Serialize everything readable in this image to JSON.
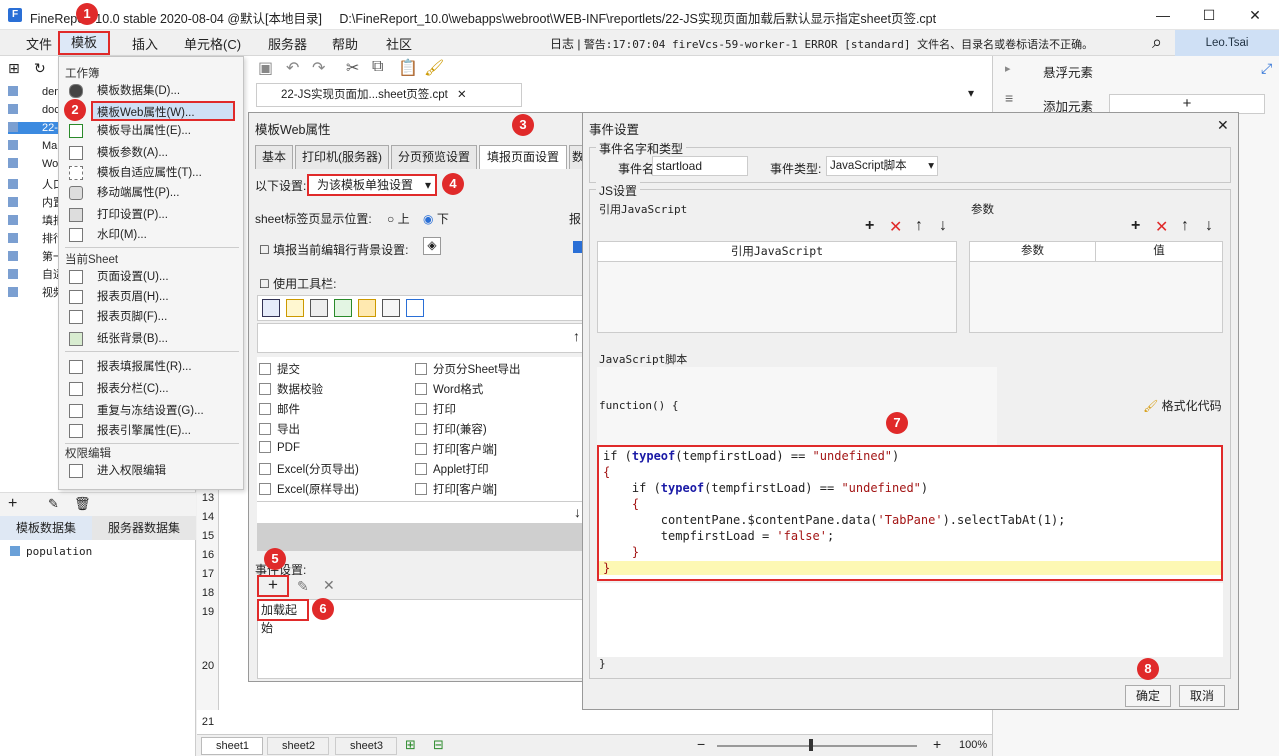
{
  "titlebar": {
    "app_title": "FineReport 10.0 stable 2020-08-04 @默认[本地目录]",
    "file_path": "D:\\FineReport_10.0\\webapps\\webroot\\WEB-INF\\reportlets/22-JS实现页面加载后默认显示指定sheet页签.cpt",
    "minimize": "—",
    "maximize": "☐",
    "close": "✕"
  },
  "menubar": {
    "items": [
      "文件",
      "模板",
      "插入",
      "单元格(C)",
      "服务器",
      "帮助",
      "社区"
    ],
    "log_label": "日志",
    "alert_text": "警告:17:07:04 fireVcs-59-worker-1 ERROR [standard] 文件名、目录名或卷标语法不正确。",
    "user": "Leo.Tsai"
  },
  "dropdown": {
    "section_workbook": "工作簿",
    "items_workbook": [
      "模板数据集(D)...",
      "模板Web属性(W)...",
      "模板导出属性(E)...",
      "模板参数(A)...",
      "模板自适应属性(T)...",
      "移动端属性(P)...",
      "打印设置(P)...",
      "水印(M)..."
    ],
    "section_sheet": "当前Sheet",
    "items_sheet1": [
      "页面设置(U)...",
      "报表页眉(H)...",
      "报表页脚(F)...",
      "纸张背景(B)..."
    ],
    "items_sheet2": [
      "报表填报属性(R)...",
      "报表分栏(C)...",
      "重复与冻结设置(G)...",
      "报表引擎属性(E)..."
    ],
    "section_perm": "权限编辑",
    "items_perm": [
      "进入权限编辑"
    ]
  },
  "left_panel": {
    "tree": [
      "dem",
      "doc",
      "22-",
      "Map",
      "Wor",
      "人口",
      "内置",
      "填报",
      "排行",
      "第一",
      "自适",
      "视频"
    ],
    "tab_template_ds": "模板数据集",
    "tab_server_ds": "服务器数据集",
    "dataset": "population"
  },
  "editor": {
    "tab_label": "22-JS实现页面加...sheet页签.cpt",
    "row_numbers": [
      "13",
      "14",
      "15",
      "16",
      "17",
      "18",
      "19",
      "20",
      "21"
    ],
    "sheets": [
      "sheet1",
      "sheet2",
      "sheet3"
    ],
    "zoom": "100%",
    "zoom_minus": "−",
    "zoom_plus": "+"
  },
  "right_panel": {
    "title": "悬浮元素",
    "add_label": "添加元素",
    "add_symbol": "+"
  },
  "dlg1": {
    "title": "模板Web属性",
    "tabs": [
      "基本",
      "打印机(服务器)",
      "分页预览设置",
      "填报页面设置",
      "数"
    ],
    "setting_label": "以下设置:",
    "setting_value": "为该模板单独设置",
    "sheet_pos_label": "sheet标签页显示位置:",
    "pos_top": "上",
    "pos_bottom": "下",
    "cut_label": "报",
    "bg_label": "填报当前编辑行背景设置:",
    "toolbar_label": "使用工具栏:",
    "list_col1": [
      "提交",
      "数据校验",
      "邮件",
      "导出",
      "PDF",
      "Excel(分页导出)",
      "Excel(原样导出)"
    ],
    "list_col2": [
      "分页分Sheet导出",
      "Word格式",
      "打印",
      "打印(兼容)",
      "打印[客户端]",
      "Applet打印",
      "打印[客户端]"
    ],
    "event_label": "事件设置:",
    "event_add": "+",
    "event_item": "加载起始"
  },
  "dlg2": {
    "title": "事件设置",
    "group_name_type": "事件名字和类型",
    "event_name_label": "事件名:",
    "event_name_value": "startload",
    "event_type_label": "事件类型:",
    "event_type_value": "JavaScript脚本",
    "group_js": "JS设置",
    "ref_js_label": "引用JavaScript",
    "param_label": "参数",
    "ref_js_header": "引用JavaScript",
    "param_header": "参数",
    "value_header": "值",
    "js_script_label": "JavaScript脚本",
    "func_open": "function() {",
    "format_code": "格式化代码",
    "func_close": "}",
    "ok": "确定",
    "cancel": "取消",
    "tb_add": "+",
    "tb_delete": "✕",
    "tb_up": "↑",
    "tb_down": "↓"
  },
  "code_lines": [
    [
      "if (",
      "typeof",
      "(tempfirstLoad) == ",
      "\"undefined\"",
      ")"
    ],
    [
      "{",
      "",
      "",
      "",
      ""
    ],
    [
      "    if (",
      "typeof",
      "(tempfirstLoad) == ",
      "\"undefined\"",
      ")"
    ],
    [
      "    {",
      "",
      "",
      "",
      ""
    ],
    [
      "        contentPane.$contentPane.data(",
      "",
      "",
      "'TabPane'",
      ").selectTabAt(1);"
    ],
    [
      "        tempfirstLoad = ",
      "",
      "",
      "'false'",
      ";"
    ],
    [
      "    }",
      "",
      "",
      "",
      ""
    ],
    [
      "}",
      "",
      "",
      "",
      ""
    ]
  ],
  "callouts": [
    "1",
    "2",
    "3",
    "4",
    "5",
    "6",
    "7",
    "8"
  ],
  "colors": {
    "accent": "#e02a2a",
    "brand": "#2a6fd6",
    "keyword": "#1a1aa6",
    "string": "#a31515"
  },
  "icons": {
    "search": "⌕",
    "close": "✕",
    "dropdown": "▾",
    "expand": "▸",
    "settings": "≡"
  }
}
